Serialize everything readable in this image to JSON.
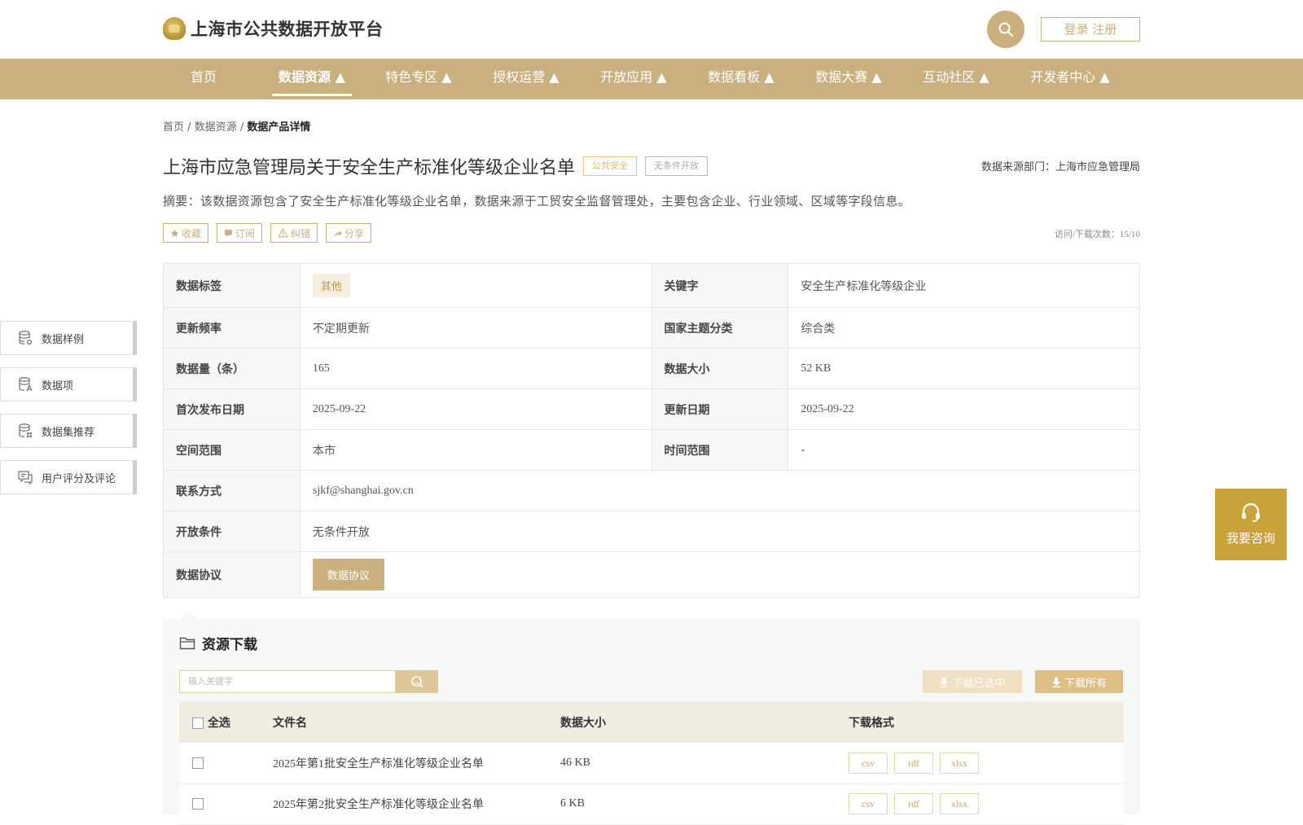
{
  "header": {
    "logo_text": "上海市公共数据开放平台",
    "login_label": "登录 注册"
  },
  "nav": [
    {
      "label": "首页"
    },
    {
      "label": "数据资源 ▲"
    },
    {
      "label": "特色专区 ▲"
    },
    {
      "label": "授权运营 ▲"
    },
    {
      "label": "开放应用 ▲"
    },
    {
      "label": "数据看板 ▲"
    },
    {
      "label": "数据大赛 ▲"
    },
    {
      "label": "互动社区 ▲"
    },
    {
      "label": "开发者中心 ▲"
    }
  ],
  "breadcrumb": {
    "home": "首页",
    "sep1": " / ",
    "section": "数据资源",
    "sep2": " / ",
    "current": "数据产品详情"
  },
  "dataset": {
    "title": "上海市应急管理局关于安全生产标准化等级企业名单",
    "tag_category": "公共安全",
    "tag_open": "无条件开放",
    "source_department": "数据来源部门：上海市应急管理局",
    "summary": "摘要：该数据资源包含了安全生产标准化等级企业名单，数据来源于工贸安全监督管理处，主要包含企业、行业领域、区域等字段信息。",
    "visits": "访问/下载次数：15/10"
  },
  "actions": {
    "favorite": "收藏",
    "subscribe": "订阅",
    "report": "纠错",
    "share": "分享"
  },
  "info": {
    "tag_label": "数据标签",
    "tag_value": "其他",
    "keyword_label": "关键字",
    "keyword_value": "安全生产标准化等级企业",
    "freq_label": "更新频率",
    "freq_value": "不定期更新",
    "theme_label": "国家主题分类",
    "theme_value": "综合类",
    "count_label": "数据量（条）",
    "count_value": "165",
    "size_label": "数据大小",
    "size_value": "52 KB",
    "first_pub_label": "首次发布日期",
    "first_pub_value": "2025-09-22",
    "update_label": "更新日期",
    "update_value": "2025-09-22",
    "space_label": "空间范围",
    "space_value": "本市",
    "time_label": "时间范围",
    "time_value": "-",
    "contact_label": "联系方式",
    "contact_value": "sjkf@shanghai.gov.cn",
    "condition_label": "开放条件",
    "condition_value": "无条件开放",
    "protocol_label": "数据协议",
    "protocol_button": "数据协议"
  },
  "sidebar": [
    {
      "label": "数据样例",
      "icon": "database-gear-icon"
    },
    {
      "label": "数据项",
      "icon": "database-text-icon"
    },
    {
      "label": "数据集推荐",
      "icon": "database-grid-icon"
    },
    {
      "label": "用户评分及评论",
      "icon": "comment-icon"
    }
  ],
  "consult": {
    "label": "我要咨询"
  },
  "download": {
    "title": "资源下载",
    "search_placeholder": "输入关键字",
    "download_selected": "下载已选中",
    "download_all": "下载所有",
    "columns": {
      "select_all": "全选",
      "filename": "文件名",
      "size": "数据大小",
      "format": "下载格式"
    },
    "files": [
      {
        "name": "2025年第1批安全生产标准化等级企业名单",
        "size": "46 KB",
        "formats": [
          "csv",
          "rdf",
          "xlsx"
        ]
      },
      {
        "name": "2025年第2批安全生产标准化等级企业名单",
        "size": "6 KB",
        "formats": [
          "csv",
          "rdf",
          "xlsx"
        ]
      }
    ]
  },
  "colors": {
    "brand_gold": "#c9b07e",
    "consult_gold": "#c9a23a"
  }
}
